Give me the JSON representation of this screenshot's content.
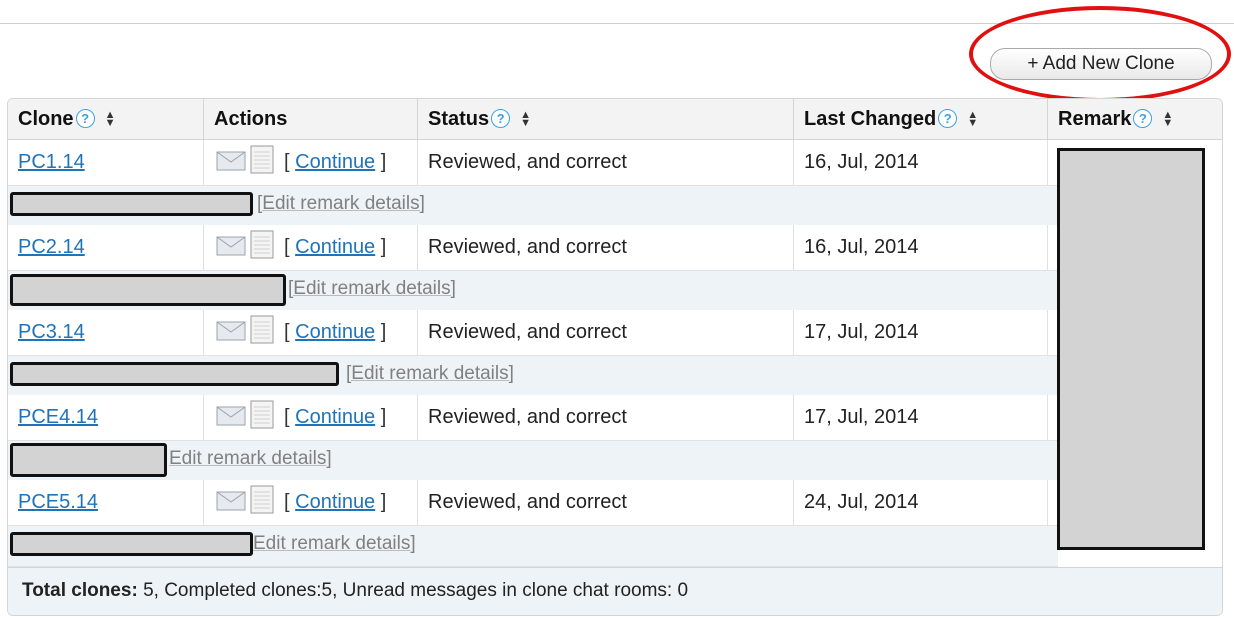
{
  "toolbar": {
    "add_button_label": "+ Add New Clone"
  },
  "table": {
    "columns": [
      {
        "label": "Clone",
        "help": true,
        "sortable": true
      },
      {
        "label": "Actions",
        "help": false,
        "sortable": false
      },
      {
        "label": "Status",
        "help": true,
        "sortable": true
      },
      {
        "label": "Last Changed",
        "help": true,
        "sortable": true
      },
      {
        "label": "Remark",
        "help": true,
        "sortable": true
      }
    ],
    "help_glyph": "?",
    "continue_label": "Continue",
    "bracket_open": "[",
    "bracket_close": "]",
    "rows": [
      {
        "clone": "PC1.14",
        "status": "Reviewed, and correct",
        "last_changed": "16, Jul, 2014",
        "edit_label": "[Edit remark details]"
      },
      {
        "clone": "PC2.14",
        "status": "Reviewed, and correct",
        "last_changed": "16, Jul, 2014",
        "edit_label": "[Edit remark details]"
      },
      {
        "clone": "PC3.14",
        "status": "Reviewed, and correct",
        "last_changed": "17, Jul, 2014",
        "edit_label": "[Edit remark details]"
      },
      {
        "clone": "PCE4.14",
        "status": "Reviewed, and correct",
        "last_changed": "17, Jul, 2014",
        "edit_label": "Edit remark details]"
      },
      {
        "clone": "PCE5.14",
        "status": "Reviewed, and correct",
        "last_changed": "24, Jul, 2014",
        "edit_label": "Edit remark details]"
      }
    ]
  },
  "footer": {
    "total_label": "Total clones:",
    "total_value": "5",
    "rest": ", Completed clones:5, Unread messages in clone chat rooms: 0"
  },
  "colors": {
    "link": "#1f73b8",
    "help": "#3aa0e8",
    "highlight": "#e01010"
  },
  "icons": [
    "help-icon",
    "sort-icon",
    "envelope-icon",
    "notepad-icon"
  ]
}
